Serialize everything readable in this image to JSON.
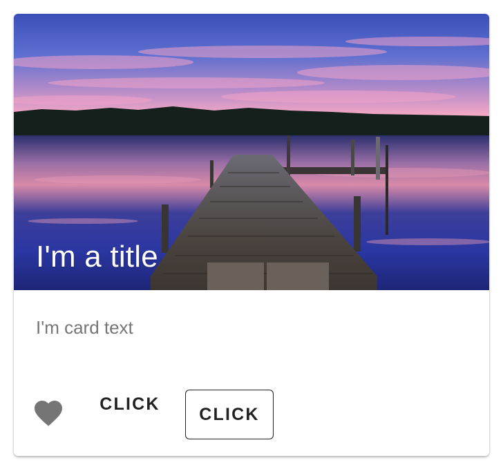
{
  "card": {
    "title": "I'm a title",
    "text": "I'm card text",
    "actions": {
      "favorite_icon": "heart-icon",
      "flat_button_label": "CLICK",
      "outlined_button_label": "CLICK"
    }
  },
  "colors": {
    "title_text": "#ffffff",
    "body_text": "#757575",
    "button_text": "#212121",
    "heart": "#757575"
  }
}
